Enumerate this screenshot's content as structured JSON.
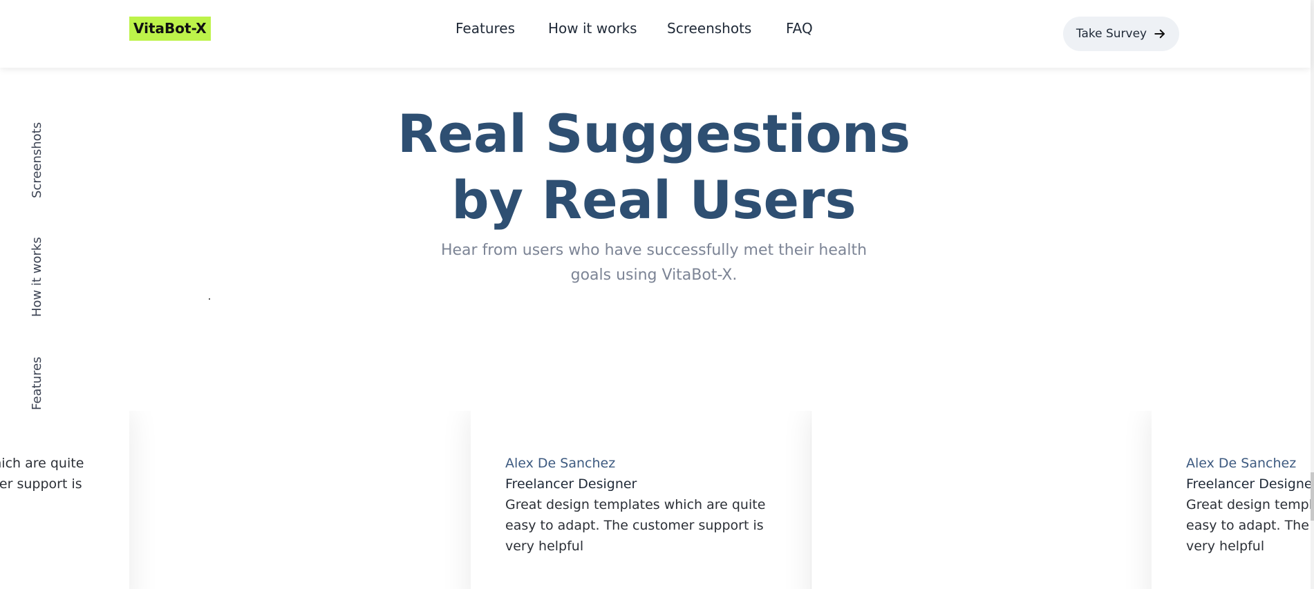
{
  "brand": {
    "name": "VitaBot-X"
  },
  "nav": {
    "items": [
      {
        "label": "Features"
      },
      {
        "label": "How it works"
      },
      {
        "label": "Screenshots"
      },
      {
        "label": "FAQ"
      }
    ]
  },
  "cta": {
    "label": "Take Survey",
    "icon": "arrow-right-icon"
  },
  "side_nav": {
    "items": [
      {
        "label": "Screenshots"
      },
      {
        "label": "How it works"
      },
      {
        "label": "Features"
      }
    ]
  },
  "hero": {
    "title_line1": "Real Suggestions",
    "title_line2": "by Real Users",
    "subtitle": "Hear from users who have successfully met their health goals using VitaBot-X."
  },
  "testimonials": [
    {
      "name": "",
      "role": "",
      "quote": "Great design templates which are quite easy to adapt. The customer support is very helpful"
    },
    {
      "name": "Alex De Sanchez",
      "role": "Freelancer Designer",
      "quote": "Great design templates which are quite easy to adapt. The customer support is very helpful"
    },
    {
      "name": "",
      "role": "",
      "quote": ""
    },
    {
      "name": "Alex De Sanchez",
      "role": "Freelancer Designer",
      "quote": "Great design templates which are quite easy to adapt. The customer support is very helpful"
    }
  ],
  "colors": {
    "accent": "#bdf34a",
    "heading": "#2e4f72",
    "muted": "#7c8495",
    "cta_bg": "#eef1f5",
    "name": "#3d5a80"
  }
}
